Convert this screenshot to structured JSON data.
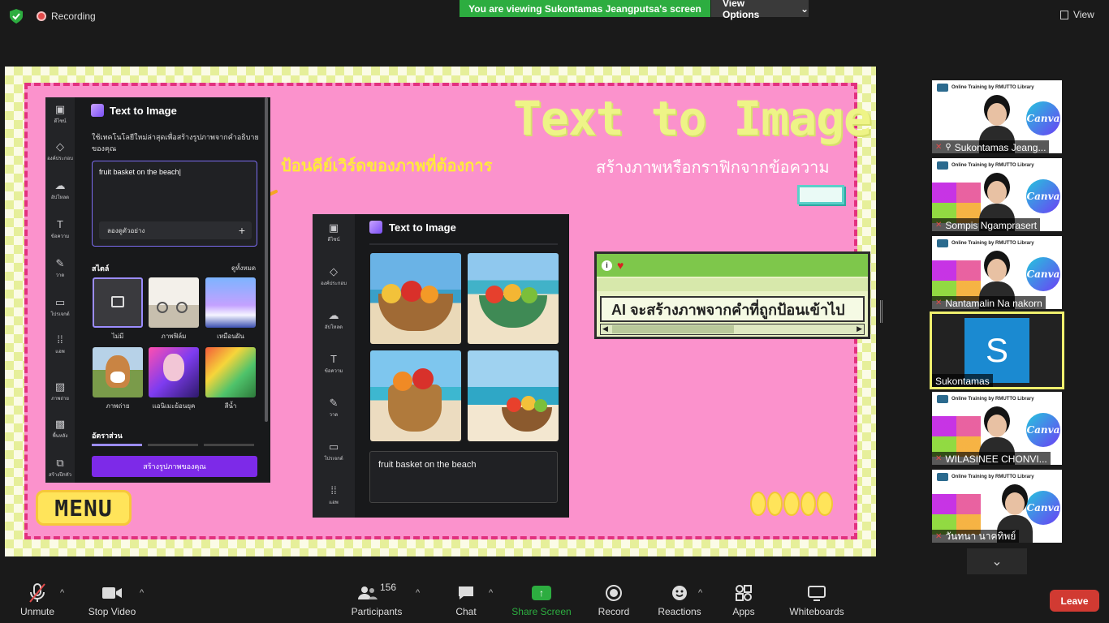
{
  "topbar": {
    "recording_label": "Recording",
    "viewing_banner": "You are viewing Sukontamas Jeangputsa's screen",
    "view_options_label": "View Options",
    "view_label": "View"
  },
  "slide": {
    "title": "Text to Image",
    "subtitle": "สร้างภาพหรือกราฟิกจากข้อความ",
    "keyword_hint": "ป้อนคีย์เวิร์ดของภาพที่ต้องการ",
    "menu_label": "MENU",
    "window_text": "AI จะสร้างภาพจากคำที่ถูกป้อนเข้าไป",
    "left_panel": {
      "title": "Text to Image",
      "description": "ใช้เทคโนโลยีใหม่ล่าสุดเพื่อสร้างรูปภาพจากคำอธิบายของคุณ",
      "input_value": "fruit basket on the beach",
      "example_label": "ลองดูตัวอย่าง",
      "style_heading": "สไตล์",
      "see_all": "ดูทั้งหมด",
      "styles": [
        {
          "label": "ไม่มี"
        },
        {
          "label": "ภาพฟิล์ม"
        },
        {
          "label": "เหมือนฝัน"
        },
        {
          "label": "ภาพถ่าย"
        },
        {
          "label": "แอนิเมะย้อนยุค"
        },
        {
          "label": "สีน้ำ"
        }
      ],
      "ratio_heading": "อัตราส่วน",
      "generate_button": "สร้างรูปภาพของคุณ",
      "rail": [
        "ดีไซน์",
        "องค์ประกอบ",
        "อัปโหลด",
        "ข้อความ",
        "วาด",
        "โปรเจกต์",
        "แอพ",
        "ภาพถ่าย",
        "พื้นหลัง",
        "สร้างปีกหัว"
      ]
    },
    "middle_panel": {
      "title": "Text to Image",
      "prompt": "fruit basket on the beach",
      "rail": [
        "ดีไซน์",
        "องค์ประกอบ",
        "อัปโหลด",
        "ข้อความ",
        "วาด",
        "โปรเจกต์",
        "แอพ"
      ]
    }
  },
  "participants": [
    {
      "name": "Sukontamas Jeang..."
    },
    {
      "name": "Sompis Ngamprasert"
    },
    {
      "name": "Nantamalin Na nakorn"
    },
    {
      "name": "Sukontamas",
      "avatar_letter": "S"
    },
    {
      "name": "WILASINEE CHONVI..."
    },
    {
      "name": "วันทนา นาคทิพย์"
    }
  ],
  "tile_header": "Online Training by RMUTTO Library",
  "canva_logo": "Canva",
  "toolbar": {
    "unmute": "Unmute",
    "stop_video": "Stop Video",
    "participants": "Participants",
    "participants_count": "156",
    "chat": "Chat",
    "share_screen": "Share Screen",
    "record": "Record",
    "reactions": "Reactions",
    "apps": "Apps",
    "whiteboards": "Whiteboards",
    "leave": "Leave"
  },
  "colors": {
    "banner_green": "#2dad40",
    "slide_pink": "#fb92cc",
    "canva_purple": "#7d2ae8",
    "leave_red": "#d13a32"
  }
}
